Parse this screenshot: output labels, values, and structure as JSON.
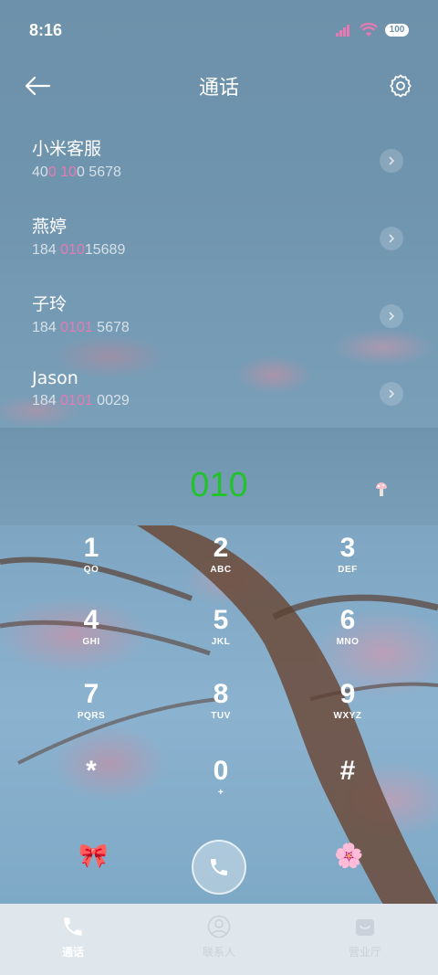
{
  "status_bar": {
    "time": "8:16",
    "battery": "100"
  },
  "header": {
    "title": "通话",
    "back_icon": "arrow-left-icon",
    "settings_icon": "gear-icon"
  },
  "contacts": [
    {
      "name": "小米客服",
      "number_parts": [
        "40",
        "0",
        " ",
        "10",
        "0 5678"
      ]
    },
    {
      "name": "燕婷",
      "number_parts": [
        "184 ",
        "010",
        "15689"
      ]
    },
    {
      "name": "子玲",
      "number_parts": [
        "184 ",
        "0101",
        " 5678"
      ]
    },
    {
      "name": "Jason",
      "number_parts": [
        "184 ",
        "0101",
        " 0029"
      ]
    }
  ],
  "dialer": {
    "input": "010",
    "input_color": "#23c12e"
  },
  "keypad": [
    {
      "num": "1",
      "letters": "QO"
    },
    {
      "num": "2",
      "letters": "ABC"
    },
    {
      "num": "3",
      "letters": "DEF"
    },
    {
      "num": "4",
      "letters": "GHI"
    },
    {
      "num": "5",
      "letters": "JKL"
    },
    {
      "num": "6",
      "letters": "MNO"
    },
    {
      "num": "7",
      "letters": "PQRS"
    },
    {
      "num": "8",
      "letters": "TUV"
    },
    {
      "num": "9",
      "letters": "WXYZ"
    },
    {
      "num": "*",
      "letters": ""
    },
    {
      "num": "0",
      "letters": "+"
    },
    {
      "num": "#",
      "letters": ""
    }
  ],
  "actions": {
    "left_emoji": "🎀",
    "right_emoji": "🌸",
    "call_icon": "phone-icon"
  },
  "bottom_nav": [
    {
      "label": "通话",
      "icon": "phone-icon",
      "active": true
    },
    {
      "label": "联系人",
      "icon": "person-icon",
      "active": false
    },
    {
      "label": "营业厅",
      "icon": "store-icon",
      "active": false
    }
  ],
  "colors": {
    "highlight": "#e879b3",
    "background": "#6e93ad",
    "nav_bg": "#dfe6ec"
  }
}
